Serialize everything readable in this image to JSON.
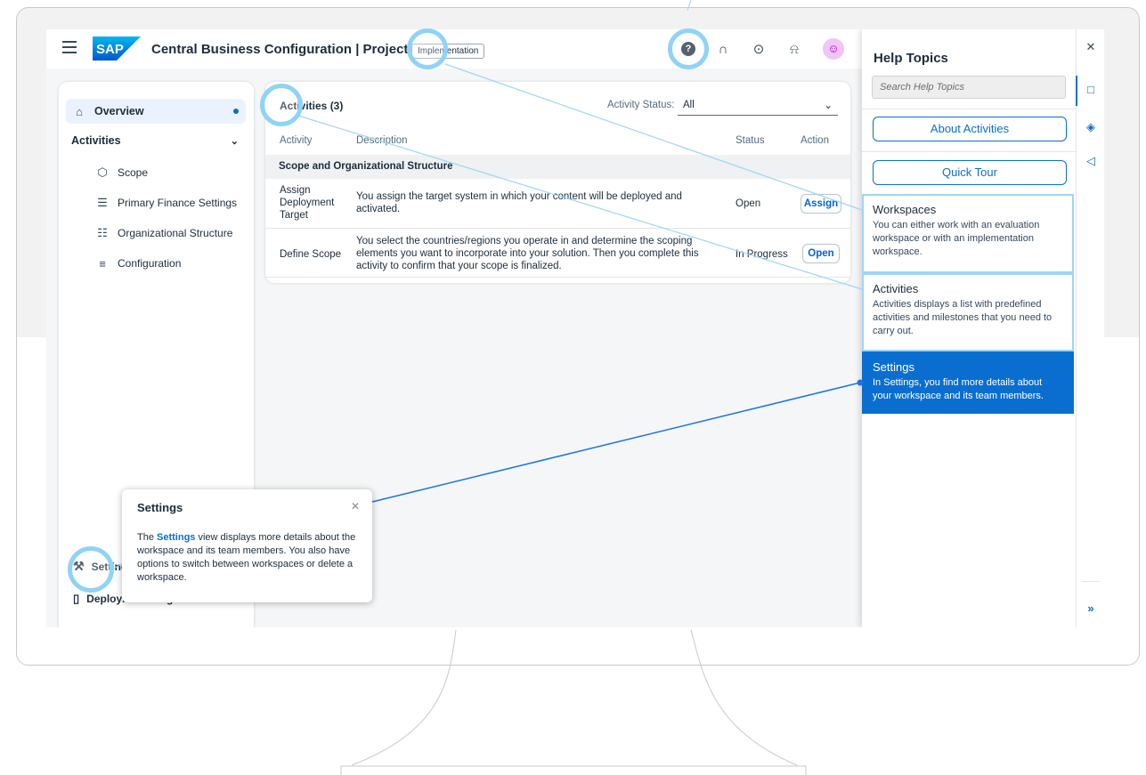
{
  "shell": {
    "menu_icon": "hamburger-menu-icon",
    "logo": "SAP",
    "title": "Central Business Configuration | Project Title",
    "workspace_tag": "Implementation",
    "icons": [
      "help-icon",
      "headset-icon",
      "feedback-icon",
      "bell-icon",
      "user-avatar-icon"
    ]
  },
  "sidenav": {
    "overview": "Overview",
    "activities": "Activities",
    "items": [
      {
        "label": "Scope",
        "icon": "scope-icon"
      },
      {
        "label": "Primary Finance Settings",
        "icon": "finance-settings-icon"
      },
      {
        "label": "Organizational Structure",
        "icon": "org-structure-icon"
      },
      {
        "label": "Configuration",
        "icon": "configuration-icon"
      }
    ],
    "settings": "Settings",
    "deployment": "Deployment Target"
  },
  "activities_card": {
    "title": "Activities (3)",
    "status_label": "Activity Status:",
    "status_value": "All",
    "columns": [
      "Activity",
      "Description",
      "Status",
      "Action"
    ],
    "group": "Scope and Organizational Structure",
    "rows": [
      {
        "activity": "Assign Deployment Target",
        "description": "You assign the target system in which your content will be deployed and activated.",
        "status": "Open",
        "action": "Assign"
      },
      {
        "activity": "Define Scope",
        "description": "You select the countries/regions you operate in and determine the scoping elements you want to incorporate into your solution. Then you complete this activity to confirm that your scope is finalized.",
        "status": "In Progress",
        "action": "Open"
      }
    ]
  },
  "help_panel": {
    "title": "Help Topics",
    "search_placeholder": "Search Help Topics",
    "about_button": "About Activities",
    "tour_button": "Quick Tour",
    "topics": [
      {
        "title": "Workspaces",
        "desc": "You can either work with an evaluation workspace or with an implementation workspace."
      },
      {
        "title": "Activities",
        "desc": "Activities displays a list with predefined activities and milestones that you need to carry out."
      },
      {
        "title": "Settings",
        "desc": "In Settings, you find more details about your workspace and its team members."
      }
    ]
  },
  "popover": {
    "title": "Settings",
    "text_pre": "The ",
    "text_link": "Settings",
    "text_post": " view displays more details about the workspace and its team members. You also have options to switch between workspaces or delete a workspace."
  },
  "colors": {
    "accent": "#0a6ed1",
    "highlight": "#8fd3f7"
  }
}
